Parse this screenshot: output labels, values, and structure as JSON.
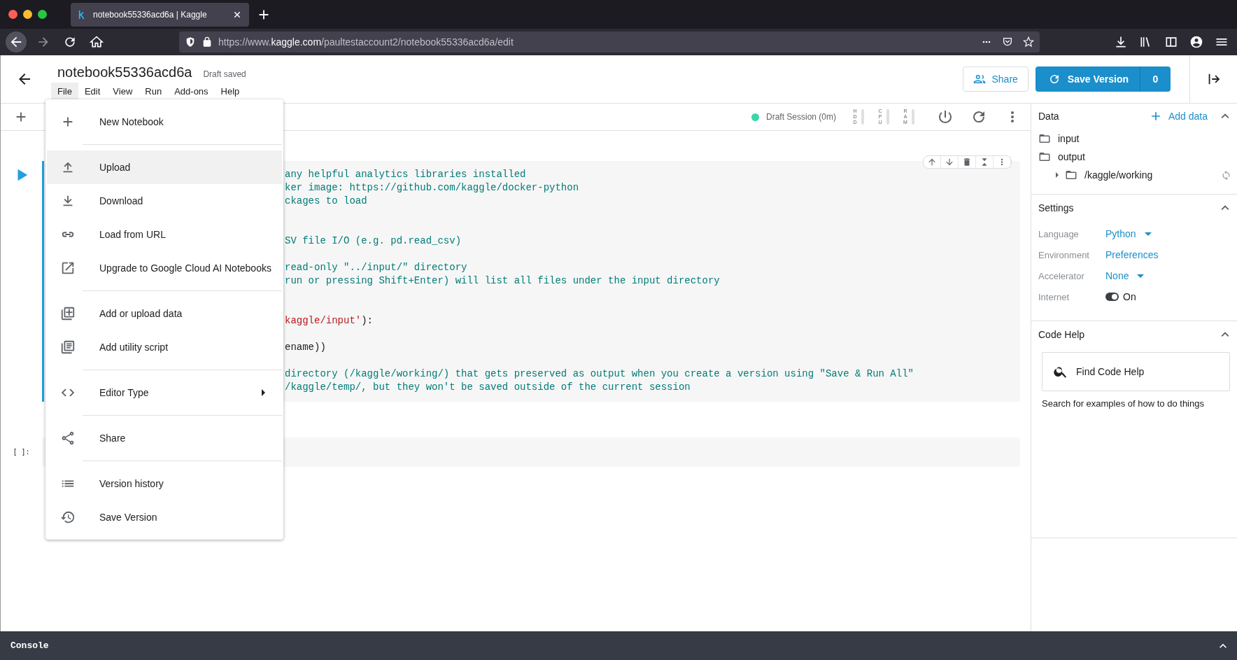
{
  "browser": {
    "tab_title": "notebook55336acd6a | Kaggle",
    "url": "https://www.**kaggle.com**/paultestaccount2/notebook55336acd6a/edit"
  },
  "header": {
    "title": "notebook55336acd6a",
    "status": "Draft saved",
    "menus": [
      {
        "label": "File",
        "selected": true
      },
      {
        "label": "Edit",
        "selected": false
      },
      {
        "label": "View",
        "selected": false
      },
      {
        "label": "Run",
        "selected": false
      },
      {
        "label": "Add-ons",
        "selected": false
      },
      {
        "label": "Help",
        "selected": false
      }
    ],
    "share": "Share",
    "save_version": "Save Version",
    "version_count": "0"
  },
  "toolbar": {
    "session": "Draft Session (0m)",
    "session_active": true,
    "meters": [
      {
        "label": "HDD"
      },
      {
        "label": "CPU"
      },
      {
        "label": "RAM"
      }
    ]
  },
  "file_menu": {
    "items": [
      {
        "label": "New Notebook",
        "selected": false,
        "separated": false,
        "submenu": false
      },
      {
        "label": "Upload",
        "selected": true,
        "separated": true,
        "submenu": false
      },
      {
        "label": "Download",
        "selected": false,
        "separated": false,
        "submenu": false
      },
      {
        "label": "Load from URL",
        "selected": false,
        "separated": false,
        "submenu": false
      },
      {
        "label": "Upgrade to Google Cloud AI Notebooks",
        "selected": false,
        "separated": false,
        "submenu": false
      },
      {
        "label": "Add or upload data",
        "selected": false,
        "separated": true,
        "submenu": false
      },
      {
        "label": "Add utility script",
        "selected": false,
        "separated": false,
        "submenu": false
      },
      {
        "label": "Editor Type",
        "selected": false,
        "separated": true,
        "submenu": true
      },
      {
        "label": "Share",
        "selected": false,
        "separated": true,
        "submenu": false
      },
      {
        "label": "Version history",
        "selected": false,
        "separated": true,
        "submenu": false
      },
      {
        "label": "Save Version",
        "selected": false,
        "separated": false,
        "submenu": false
      }
    ]
  },
  "cells": [
    {
      "focused": true,
      "lines": [
        {
          "tokens": [
            {
              "kind": "comment",
              "text": "any helpful analytics libraries installed"
            }
          ]
        },
        {
          "tokens": [
            {
              "kind": "comment",
              "text": "ker image: https://github.com/kaggle/docker-python"
            }
          ]
        },
        {
          "tokens": [
            {
              "kind": "comment",
              "text": "ckages to load"
            }
          ]
        },
        {
          "kind": "blank"
        },
        {
          "kind": "blank"
        },
        {
          "tokens": [
            {
              "kind": "comment",
              "text": "SV file I/O (e.g. pd.read_csv)"
            }
          ]
        },
        {
          "kind": "blank"
        },
        {
          "tokens": [
            {
              "kind": "comment",
              "text": "read-only \"../input/\" directory"
            }
          ]
        },
        {
          "tokens": [
            {
              "kind": "comment",
              "text": "run or pressing Shift+Enter) will list all files under the input directory"
            }
          ]
        },
        {
          "kind": "blank"
        },
        {
          "kind": "blank"
        },
        {
          "tokens": [
            {
              "kind": "string",
              "text": "kaggle/input'"
            },
            {
              "kind": "plain",
              "text": "):"
            }
          ]
        },
        {
          "kind": "blank"
        },
        {
          "tokens": [
            {
              "kind": "plain",
              "text": "ename))"
            }
          ]
        },
        {
          "kind": "blank"
        },
        {
          "tokens": [
            {
              "kind": "comment",
              "text": "directory (/kaggle/working/) that gets preserved as output when you create a version using \"Save & Run All\""
            }
          ]
        },
        {
          "tokens": [
            {
              "kind": "comment",
              "text": "/kaggle/temp/, but they won't be saved outside of the current session"
            }
          ]
        }
      ]
    },
    {
      "focused": false,
      "prompt": "[ ]:"
    }
  ],
  "side_panel": {
    "data": {
      "title": "Data",
      "expanded": true,
      "add": "Add data",
      "items": [
        {
          "label": "input"
        },
        {
          "label": "output",
          "children": [
            {
              "label": "/kaggle/working",
              "expanded": false
            }
          ]
        }
      ]
    },
    "settings": {
      "title": "Settings",
      "expanded": true,
      "rows": [
        {
          "kind": "dropdown",
          "label": "Language",
          "value": "Python"
        },
        {
          "kind": "link",
          "label": "Environment",
          "value": "Preferences"
        },
        {
          "kind": "dropdown",
          "label": "Accelerator",
          "value": "None"
        },
        {
          "kind": "toggle",
          "label": "Internet",
          "on": true,
          "value": "On"
        }
      ]
    },
    "code_help": {
      "title": "Code Help",
      "expanded": true,
      "placeholder": "Find Code Help",
      "hint": "Search for examples of how to do things"
    }
  },
  "console": {
    "title": "Console",
    "expanded": false
  }
}
